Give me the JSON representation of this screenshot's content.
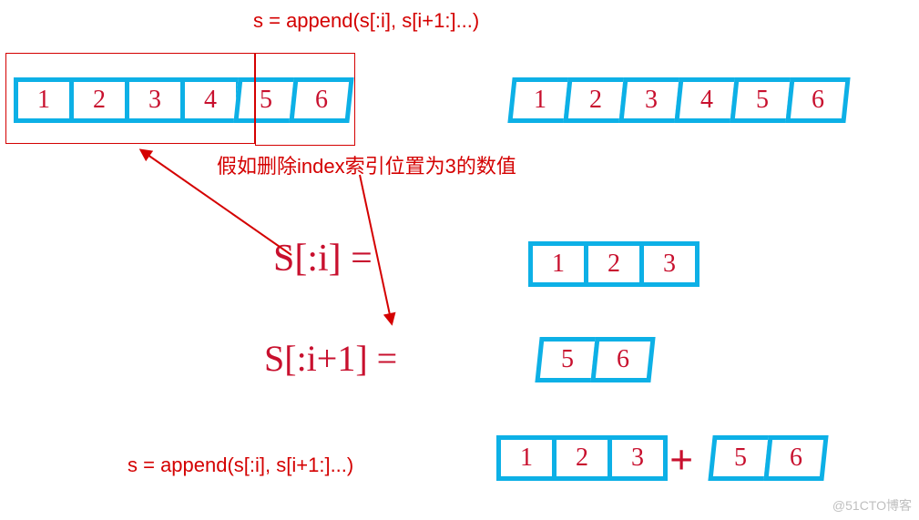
{
  "title_formula": "s = append(s[:i], s[i+1:]...)",
  "caption_delete": "假如删除index索引位置为3的数值",
  "bottom_formula": "s = append(s[:i], s[i+1:]...)",
  "watermark": "@51CTO博客",
  "array_full": [
    "1",
    "2",
    "3",
    "4",
    "5",
    "6"
  ],
  "array_full_copy": [
    "1",
    "2",
    "3",
    "4",
    "5",
    "6"
  ],
  "slice_head_label": "S[:i]  =",
  "slice_head": [
    "1",
    "2",
    "3"
  ],
  "slice_tail_label": "S[:i+1]  =",
  "slice_tail": [
    "5",
    "6"
  ],
  "result_head": [
    "1",
    "2",
    "3"
  ],
  "result_tail": [
    "5",
    "6"
  ],
  "colors": {
    "cell_border": "#0db0e6",
    "hand_red": "#c8102e",
    "text_red": "#d40000"
  },
  "chart_data": {
    "type": "table",
    "title": "Go slice element deletion via append",
    "expression": "s = append(s[:i], s[i+1:]...)",
    "note_zh": "假如删除index索引位置为3的数值",
    "original_slice": [
      1,
      2,
      3,
      4,
      5,
      6
    ],
    "delete_index_1based": 3,
    "slice_before_i": [
      1,
      2,
      3
    ],
    "slice_from_i_plus_1": [
      5,
      6
    ],
    "result": [
      1,
      2,
      3,
      5,
      6
    ]
  }
}
